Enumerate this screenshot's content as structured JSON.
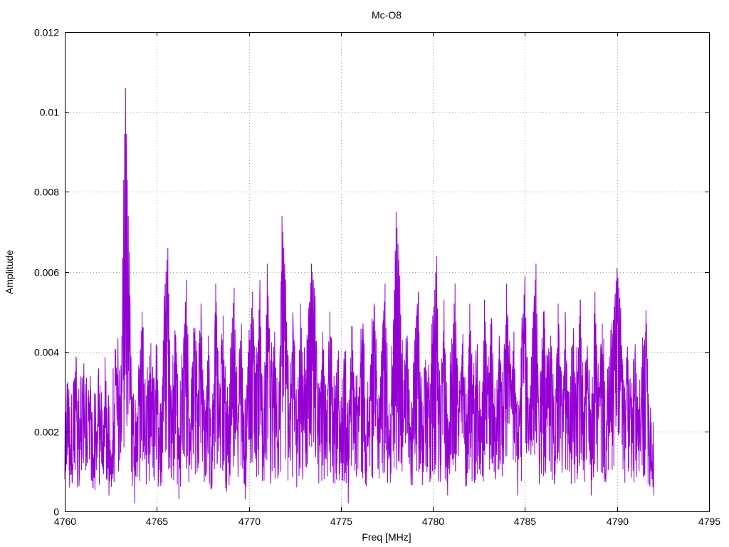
{
  "chart_data": {
    "type": "line",
    "title": "Mc-O8",
    "xlabel": "Freq [MHz]",
    "ylabel": "Amplitude",
    "xlim": [
      4760,
      4795
    ],
    "ylim": [
      0,
      0.012
    ],
    "xticks": [
      "4760",
      "4765",
      "4770",
      "4775",
      "4780",
      "4785",
      "4790",
      "4795"
    ],
    "yticks": [
      "0",
      "0.002",
      "0.004",
      "0.006",
      "0.008",
      "0.01",
      "0.012"
    ],
    "grid": true,
    "legend": "none",
    "series": [
      {
        "color": "#9400d3",
        "noise_floor": 0.0024,
        "x_start": 4760.0,
        "x_end": 4792.0,
        "points": [
          [
            4760.0,
            0.0008
          ],
          [
            4760.2,
            0.0016
          ],
          [
            4760.4,
            0.0007
          ],
          [
            4760.6,
            0.0026
          ],
          [
            4760.8,
            0.0012
          ],
          [
            4761.0,
            0.0034
          ],
          [
            4761.2,
            0.0015
          ],
          [
            4761.4,
            0.003
          ],
          [
            4761.6,
            0.0009
          ],
          [
            4761.8,
            0.0024
          ],
          [
            4762.0,
            0.0012
          ],
          [
            4762.2,
            0.0031
          ],
          [
            4762.4,
            0.0004
          ],
          [
            4762.6,
            0.0018
          ],
          [
            4762.8,
            0.0036
          ],
          [
            4763.0,
            0.0029
          ],
          [
            4763.1,
            0.0044
          ],
          [
            4763.2,
            0.0083
          ],
          [
            4763.3,
            0.0106
          ],
          [
            4763.4,
            0.0083
          ],
          [
            4763.5,
            0.0065
          ],
          [
            4763.6,
            0.0038
          ],
          [
            4763.8,
            0.0002
          ],
          [
            4764.0,
            0.0031
          ],
          [
            4764.2,
            0.005
          ],
          [
            4764.4,
            0.0014
          ],
          [
            4764.6,
            0.0039
          ],
          [
            4764.8,
            0.0021
          ],
          [
            4765.0,
            0.0033
          ],
          [
            4765.2,
            0.0009
          ],
          [
            4765.4,
            0.0054
          ],
          [
            4765.6,
            0.0066
          ],
          [
            4765.8,
            0.002
          ],
          [
            4766.0,
            0.0043
          ],
          [
            4766.2,
            0.0003
          ],
          [
            4766.4,
            0.0036
          ],
          [
            4766.6,
            0.0058
          ],
          [
            4766.8,
            0.0012
          ],
          [
            4767.0,
            0.0046
          ],
          [
            4767.2,
            0.0023
          ],
          [
            4767.4,
            0.0052
          ],
          [
            4767.6,
            0.0019
          ],
          [
            4767.8,
            0.0044
          ],
          [
            4768.0,
            0.0007
          ],
          [
            4768.2,
            0.0057
          ],
          [
            4768.4,
            0.0025
          ],
          [
            4768.6,
            0.0049
          ],
          [
            4768.8,
            0.0005
          ],
          [
            4769.0,
            0.0041
          ],
          [
            4769.2,
            0.0056
          ],
          [
            4769.4,
            0.0014
          ],
          [
            4769.6,
            0.0047
          ],
          [
            4769.8,
            0.0003
          ],
          [
            4770.0,
            0.0039
          ],
          [
            4770.2,
            0.0055
          ],
          [
            4770.4,
            0.0028
          ],
          [
            4770.6,
            0.0058
          ],
          [
            4770.8,
            0.0011
          ],
          [
            4771.0,
            0.0062
          ],
          [
            4771.2,
            0.003
          ],
          [
            4771.4,
            0.0045
          ],
          [
            4771.6,
            0.0009
          ],
          [
            4771.8,
            0.0074
          ],
          [
            4772.0,
            0.0058
          ],
          [
            4772.2,
            0.0016
          ],
          [
            4772.4,
            0.0048
          ],
          [
            4772.6,
            0.0006
          ],
          [
            4772.8,
            0.0052
          ],
          [
            4773.0,
            0.0028
          ],
          [
            4773.2,
            0.0043
          ],
          [
            4773.4,
            0.0062
          ],
          [
            4773.6,
            0.0054
          ],
          [
            4773.8,
            0.0007
          ],
          [
            4774.0,
            0.0045
          ],
          [
            4774.2,
            0.0013
          ],
          [
            4774.4,
            0.005
          ],
          [
            4774.6,
            0.0025
          ],
          [
            4774.8,
            0.0038
          ],
          [
            4775.0,
            0.0012
          ],
          [
            4775.2,
            0.004
          ],
          [
            4775.4,
            0.0002
          ],
          [
            4775.6,
            0.0046
          ],
          [
            4775.8,
            0.0022
          ],
          [
            4776.0,
            0.0031
          ],
          [
            4776.2,
            0.0047
          ],
          [
            4776.4,
            0.001
          ],
          [
            4776.6,
            0.0035
          ],
          [
            4776.8,
            0.0052
          ],
          [
            4777.0,
            0.0018
          ],
          [
            4777.2,
            0.0039
          ],
          [
            4777.4,
            0.0057
          ],
          [
            4777.6,
            0.0013
          ],
          [
            4777.8,
            0.0036
          ],
          [
            4778.0,
            0.0075
          ],
          [
            4778.2,
            0.0059
          ],
          [
            4778.4,
            0.002
          ],
          [
            4778.6,
            0.0044
          ],
          [
            4778.8,
            0.0009
          ],
          [
            4779.0,
            0.0043
          ],
          [
            4779.2,
            0.0055
          ],
          [
            4779.4,
            0.0015
          ],
          [
            4779.6,
            0.0038
          ],
          [
            4779.8,
            0.0027
          ],
          [
            4780.0,
            0.0047
          ],
          [
            4780.2,
            0.0064
          ],
          [
            4780.4,
            0.0011
          ],
          [
            4780.6,
            0.0053
          ],
          [
            4780.8,
            0.0004
          ],
          [
            4781.0,
            0.0037
          ],
          [
            4781.2,
            0.0057
          ],
          [
            4781.4,
            0.0019
          ],
          [
            4781.6,
            0.0042
          ],
          [
            4781.8,
            0.0009
          ],
          [
            4782.0,
            0.0052
          ],
          [
            4782.2,
            0.0025
          ],
          [
            4782.4,
            0.0038
          ],
          [
            4782.6,
            0.0012
          ],
          [
            4782.8,
            0.0053
          ],
          [
            4783.0,
            0.0031
          ],
          [
            4783.2,
            0.0046
          ],
          [
            4783.4,
            0.0008
          ],
          [
            4783.6,
            0.0044
          ],
          [
            4783.8,
            0.0016
          ],
          [
            4784.0,
            0.0057
          ],
          [
            4784.2,
            0.0026
          ],
          [
            4784.4,
            0.0045
          ],
          [
            4784.6,
            0.0004
          ],
          [
            4784.8,
            0.004
          ],
          [
            4785.0,
            0.0059
          ],
          [
            4785.2,
            0.0017
          ],
          [
            4785.4,
            0.0046
          ],
          [
            4785.6,
            0.0062
          ],
          [
            4785.8,
            0.0012
          ],
          [
            4786.0,
            0.005
          ],
          [
            4786.2,
            0.0028
          ],
          [
            4786.4,
            0.0044
          ],
          [
            4786.6,
            0.0008
          ],
          [
            4786.8,
            0.0052
          ],
          [
            4787.0,
            0.0021
          ],
          [
            4787.2,
            0.0047
          ],
          [
            4787.4,
            0.001
          ],
          [
            4787.6,
            0.0041
          ],
          [
            4787.8,
            0.0029
          ],
          [
            4788.0,
            0.0053
          ],
          [
            4788.2,
            0.0015
          ],
          [
            4788.4,
            0.0038
          ],
          [
            4788.6,
            0.0004
          ],
          [
            4788.8,
            0.0055
          ],
          [
            4789.0,
            0.0023
          ],
          [
            4789.2,
            0.0047
          ],
          [
            4789.4,
            0.0009
          ],
          [
            4789.6,
            0.0034
          ],
          [
            4789.8,
            0.0048
          ],
          [
            4790.0,
            0.0061
          ],
          [
            4790.2,
            0.0051
          ],
          [
            4790.4,
            0.0013
          ],
          [
            4790.6,
            0.0038
          ],
          [
            4790.8,
            0.0018
          ],
          [
            4791.0,
            0.0031
          ],
          [
            4791.2,
            0.001
          ],
          [
            4791.4,
            0.0039
          ],
          [
            4791.6,
            0.0047
          ],
          [
            4791.8,
            0.0012
          ],
          [
            4792.0,
            0.0004
          ]
        ]
      }
    ]
  }
}
